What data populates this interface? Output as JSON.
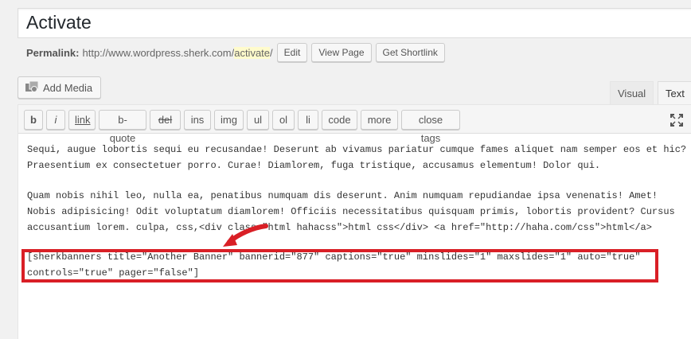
{
  "post": {
    "title": "Activate"
  },
  "permalink": {
    "label": "Permalink:",
    "base_url": "http://www.wordpress.sherk.com/",
    "slug": "activate",
    "trailing": "/",
    "buttons": {
      "edit": "Edit",
      "view_page": "View Page",
      "get_shortlink": "Get Shortlink"
    }
  },
  "media": {
    "add_media_label": "Add Media"
  },
  "editor_tabs": {
    "visual": "Visual",
    "text": "Text"
  },
  "quicktags": [
    "b",
    "i",
    "link",
    "b-quote",
    "del",
    "ins",
    "img",
    "ul",
    "ol",
    "li",
    "code",
    "more",
    "close tags"
  ],
  "content": {
    "para1": "Sequi, augue lobortis sequi eu recusandae! Deserunt ab vivamus pariatur cumque fames aliquet nam semper eos et hic? Praesentium ex consectetuer porro. Curae! Diamlorem, fuga tristique, accusamus elementum! Dolor qui.",
    "para2": "Quam nobis nihil leo, nulla ea, penatibus numquam dis deserunt. Anim numquam repudiandae ipsa venenatis! Amet! Nobis adipisicing! Odit voluptatum diamlorem! Officiis necessitatibus quisquam primis, lobortis provident? Cursus accusantium lorem. culpa, css,<div class=\"html hahacss\">html css</div> <a href=\"http://haha.com/css\">html</a>",
    "shortcode_line1": "[sherkbanners title=\"Another Banner\" bannerid=\"877\" captions=\"true\" minslides=\"1\" maxslides=\"1\" auto=\"true\"",
    "shortcode_line2": "controls=\"true\" pager=\"false\"]"
  },
  "colors": {
    "highlight": "#d91f26",
    "slug_bg": "#fffbcc"
  }
}
